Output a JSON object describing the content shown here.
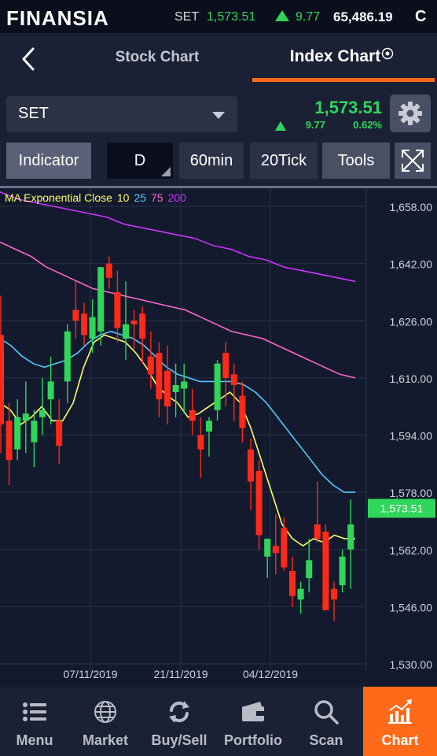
{
  "ticker": {
    "logo": "FINANSIA",
    "index_name": "SET",
    "value": "1,573.51",
    "change": "9.77",
    "volume": "65,486.19",
    "status": "C"
  },
  "tabs": {
    "stock": "Stock Chart",
    "index": "Index Chart"
  },
  "symbol": {
    "selected": "SET",
    "price": "1,573.51",
    "change": "9.77",
    "change_pct": "0.62%"
  },
  "toolbar": {
    "indicator": "Indicator",
    "period_d": "D",
    "period_60": "60min",
    "period_20tick": "20Tick",
    "tools": "Tools"
  },
  "nav": {
    "menu": "Menu",
    "market": "Market",
    "buysell": "Buy/Sell",
    "portfolio": "Portfolio",
    "scan": "Scan",
    "chart": "Chart"
  },
  "colors": {
    "accent": "#ff6a1a",
    "up": "#2fd65a",
    "down": "#ff2a1a",
    "ma10": "#ffff66",
    "ma25": "#55c8ff",
    "ma75": "#ff66cc",
    "ma200": "#cc33ff"
  },
  "chart_data": {
    "type": "candlestick",
    "legend": {
      "title": "MA Exponential Close",
      "periods": [
        "10",
        "25",
        "75",
        "200"
      ]
    },
    "y_axis": {
      "ticks": [
        "1,658.00",
        "1,642.00",
        "1,626.00",
        "1,610.00",
        "1,594.00",
        "1,578.00",
        "1,562.00",
        "1,546.00",
        "1,530.00"
      ],
      "range": [
        1530,
        1658
      ]
    },
    "x_axis": {
      "labels": [
        "07/11/2019",
        "21/11/2019",
        "04/12/2019"
      ]
    },
    "last_price_label": "1,573.51",
    "candles": [
      [
        1622,
        1633,
        1589,
        1597
      ],
      [
        1598,
        1603,
        1580,
        1587
      ],
      [
        1590,
        1604,
        1587,
        1599
      ],
      [
        1598,
        1609,
        1589,
        1600
      ],
      [
        1592,
        1601,
        1585,
        1598
      ],
      [
        1599,
        1610,
        1594,
        1601
      ],
      [
        1604,
        1616,
        1597,
        1609
      ],
      [
        1598,
        1604,
        1586,
        1591
      ],
      [
        1609,
        1625,
        1603,
        1623
      ],
      [
        1629,
        1637,
        1621,
        1626
      ],
      [
        1628,
        1631,
        1619,
        1622
      ],
      [
        1621,
        1632,
        1617,
        1627
      ],
      [
        1623,
        1641,
        1619,
        1641
      ],
      [
        1642,
        1644,
        1635,
        1638
      ],
      [
        1634,
        1640,
        1620,
        1624
      ],
      [
        1621,
        1637,
        1615,
        1625
      ],
      [
        1626,
        1629,
        1618,
        1625
      ],
      [
        1628,
        1630,
        1614,
        1621
      ],
      [
        1616,
        1623,
        1607,
        1611
      ],
      [
        1617,
        1620,
        1599,
        1604
      ],
      [
        1612,
        1619,
        1597,
        1602
      ],
      [
        1606,
        1614,
        1599,
        1608
      ],
      [
        1607,
        1614,
        1600,
        1609
      ],
      [
        1601,
        1607,
        1594,
        1598
      ],
      [
        1594,
        1599,
        1582,
        1590
      ],
      [
        1595,
        1599,
        1588,
        1598
      ],
      [
        1601,
        1615,
        1598,
        1614
      ],
      [
        1617,
        1620,
        1602,
        1610
      ],
      [
        1611,
        1614,
        1598,
        1608
      ],
      [
        1605,
        1609,
        1592,
        1596
      ],
      [
        1590,
        1593,
        1573,
        1581
      ],
      [
        1584,
        1587,
        1562,
        1566
      ],
      [
        1560,
        1565,
        1554,
        1565
      ],
      [
        1563,
        1572,
        1555,
        1561
      ],
      [
        1568,
        1571,
        1556,
        1557
      ],
      [
        1556,
        1560,
        1546,
        1549
      ],
      [
        1548,
        1553,
        1544,
        1551
      ],
      [
        1554,
        1565,
        1550,
        1559
      ],
      [
        1569,
        1581,
        1564,
        1565
      ],
      [
        1567,
        1569,
        1548,
        1545
      ],
      [
        1551,
        1553,
        1542,
        1548
      ],
      [
        1552,
        1562,
        1550,
        1560
      ],
      [
        1562,
        1576,
        1551,
        1569
      ]
    ],
    "ma": {
      "10": [
        1603,
        1601,
        1597,
        1599,
        1602,
        1598,
        1598,
        1603,
        1613,
        1620,
        1622,
        1621,
        1620,
        1617,
        1613,
        1608,
        1605,
        1603,
        1599,
        1600,
        1602,
        1604,
        1606,
        1603,
        1596,
        1587,
        1578,
        1569,
        1565,
        1563,
        1565,
        1564,
        1566,
        1565,
        1565
      ],
      "25": [
        1621,
        1619,
        1616,
        1614,
        1613,
        1614,
        1615,
        1617,
        1620,
        1622,
        1623,
        1622,
        1621,
        1619,
        1616,
        1613,
        1611,
        1610,
        1609,
        1609,
        1609,
        1609,
        1608,
        1606,
        1603,
        1599,
        1595,
        1591,
        1587,
        1583,
        1580,
        1578,
        1578
      ],
      "75": [
        1648,
        1646,
        1644,
        1641,
        1639,
        1637,
        1635,
        1634,
        1633,
        1632,
        1631,
        1630,
        1629,
        1627,
        1625,
        1623,
        1622,
        1621,
        1619,
        1617,
        1615,
        1613,
        1611,
        1610
      ],
      "200": [
        1662,
        1660,
        1659,
        1658,
        1657,
        1656,
        1655,
        1653,
        1652,
        1651,
        1650,
        1649,
        1647,
        1646,
        1644,
        1643,
        1641,
        1640,
        1639,
        1638,
        1637
      ]
    }
  }
}
